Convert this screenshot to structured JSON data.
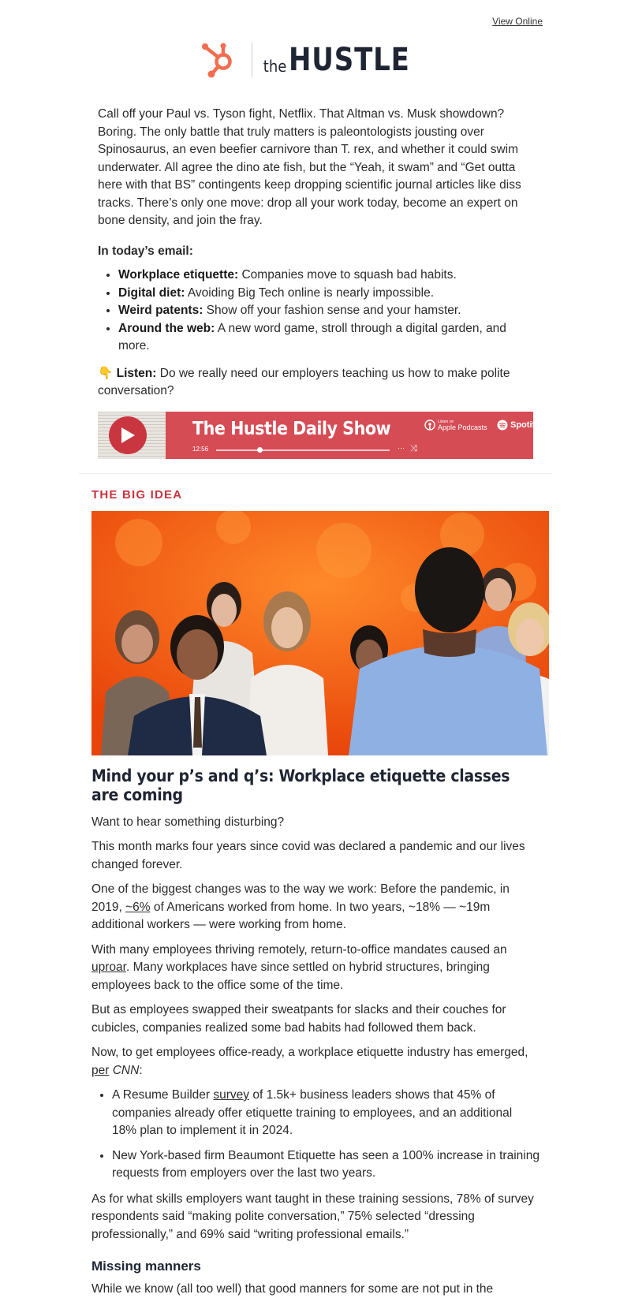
{
  "header": {
    "view_online": "View Online",
    "brand_the": "the",
    "brand_hustle": "HUSTLE"
  },
  "intro": {
    "paragraph": "Call off your Paul vs. Tyson fight, Netflix. That Altman vs. Musk showdown? Boring. The only battle that truly matters is paleontologists jousting over Spinosaurus, an even beefier carnivore than T. rex, and whether it could swim underwater. All agree the dino ate fish, but the “Yeah, it swam” and “Get outta here with that BS” contingents keep dropping scientific journal articles like diss tracks. There’s only one move: drop all your work today, become an expert on bone density, and join the fray.",
    "toc_title": "In today’s email:",
    "toc": [
      {
        "label": "Workplace etiquette:",
        "text": " Companies move to squash bad habits."
      },
      {
        "label": "Digital diet:",
        "text": " Avoiding Big Tech online is nearly impossible."
      },
      {
        "label": "Weird patents:",
        "text": " Show off your fashion sense and your hamster."
      },
      {
        "label": "Around the web:",
        "text": " A new word game, stroll through a digital garden, and more."
      }
    ],
    "listen_emoji": "👇",
    "listen_label": "Listen:",
    "listen_text": " Do we really need our employers teaching us how to make polite conversation?"
  },
  "podcast": {
    "title": "The Hustle Daily Show",
    "time": "12:56",
    "apple_small": "Listen on",
    "apple_label": "Apple Podcasts",
    "spotify_label": "Spotify",
    "progress": 0.25
  },
  "section_label": "THE BIG IDEA",
  "article": {
    "headline": "Mind your p’s and q’s: Workplace etiquette classes are coming",
    "p1": "Want to hear something disturbing?",
    "p2": "This month marks four years since covid was declared a pandemic and our lives changed forever.",
    "p3_a": "One of the biggest changes was to the way we work: Before the pandemic, in 2019, ",
    "p3_link": "~6%",
    "p3_b": " of Americans worked from home. In two years, ~18% — ~19m additional workers — were working from home.",
    "p4_a": "With many employees thriving remotely, return-to-office mandates caused an ",
    "p4_link": "uproar",
    "p4_b": ". Many workplaces have since settled on hybrid structures, bringing employees back to the office some of the time.",
    "p5": "But as employees swapped their sweatpants for slacks and their couches for cubicles, companies realized some bad habits had followed them back.",
    "p6_a": "Now, to get employees office-ready, a workplace etiquette industry has emerged, ",
    "p6_link": "per",
    "p6_src": "CNN",
    "p6_b": ":",
    "b1_a": "A Resume Builder ",
    "b1_link": "survey",
    "b1_b": " of 1.5k+ business leaders shows that 45% of companies already offer etiquette training to employees, and an additional 18% plan to implement it in 2024.",
    "b2": "New York-based firm Beaumont Etiquette has seen a 100% increase in training requests from employers over the last two years.",
    "p7": "As for what skills employers want taught in these training sessions, 78% of survey respondents said “making polite conversation,” 75% selected “dressing professionally,” and 69% said “writing professional emails.”",
    "subhead": "Missing manners",
    "p8": "While we know (all too well) that good manners for some are not put in the"
  },
  "colors": {
    "brand_orange": "#f26c4f",
    "accent_red": "#c8343e",
    "podcast_red": "#d64c55",
    "navy": "#1f2533"
  }
}
